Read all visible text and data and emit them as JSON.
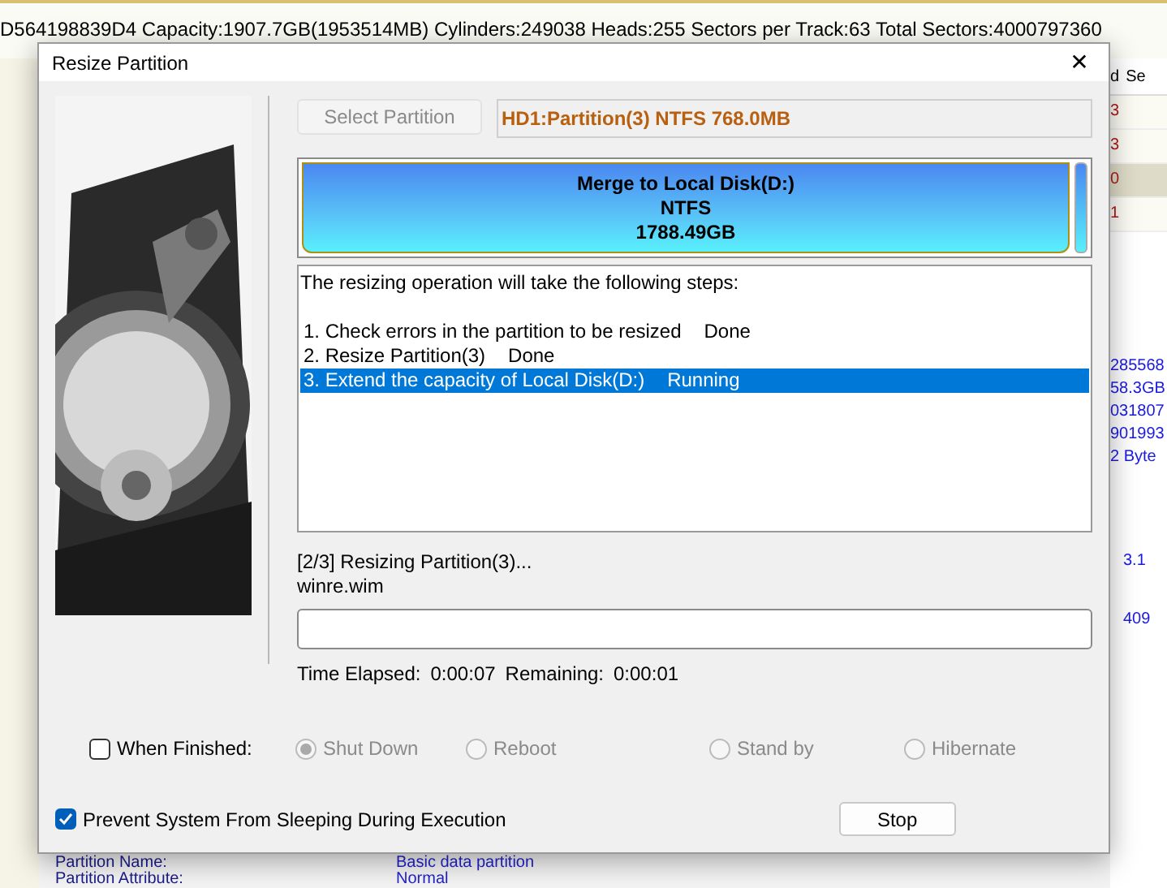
{
  "disk_info": "D564198839D4  Capacity:1907.7GB(1953514MB)  Cylinders:249038  Heads:255  Sectors per Track:63  Total Sectors:4000797360",
  "side_table": {
    "columns": [
      "d",
      "Se"
    ],
    "rows": [
      {
        "text": "3",
        "selected": false
      },
      {
        "text": "3",
        "selected": false
      },
      {
        "text": "0",
        "selected": true
      },
      {
        "text": "1",
        "selected": false
      }
    ]
  },
  "side_values": [
    "285568",
    "58.3GB",
    "031807",
    "901993",
    "2 Byte"
  ],
  "side_values_2": [
    "3.1",
    "409"
  ],
  "details": [
    {
      "label": "Partition Name:",
      "value": "Basic data partition"
    },
    {
      "label": "Partition Attribute:",
      "value": "Normal"
    }
  ],
  "dialog": {
    "title": "Resize Partition",
    "close": "✕",
    "select_button": "Select Partition",
    "partition": "HD1:Partition(3) NTFS 768.0MB",
    "target": {
      "name": "Merge to Local Disk(D:)",
      "fs": "NTFS",
      "size": "1788.49GB"
    },
    "steps_heading": "The resizing operation will take the following steps:",
    "steps": [
      {
        "label": "1. Check errors in the partition to be resized",
        "status": "Done",
        "selected": false
      },
      {
        "label": "2. Resize Partition(3)",
        "status": "Done",
        "selected": false
      },
      {
        "label": "3. Extend the capacity of Local Disk(D:)",
        "status": "Running",
        "selected": true
      }
    ],
    "status_line": "[2/3] Resizing Partition(3)...",
    "current_file": "winre.wim",
    "progress": {
      "level": 0
    },
    "time_elapsed_label": "Time Elapsed:",
    "time_elapsed": "0:00:07",
    "remaining_label": "Remaining:",
    "remaining": "0:00:01",
    "when_finished": {
      "label": "When Finished:",
      "checked": false
    },
    "finish_options": [
      {
        "label": "Shut Down",
        "selected": true,
        "disabled": true
      },
      {
        "label": "Reboot",
        "selected": false,
        "disabled": true
      },
      {
        "label": "Stand by",
        "selected": false,
        "disabled": true
      },
      {
        "label": "Hibernate",
        "selected": false,
        "disabled": true
      }
    ],
    "prevent_sleep": {
      "label": "Prevent System From Sleeping During Execution",
      "checked": true
    },
    "stop_button": "Stop"
  }
}
